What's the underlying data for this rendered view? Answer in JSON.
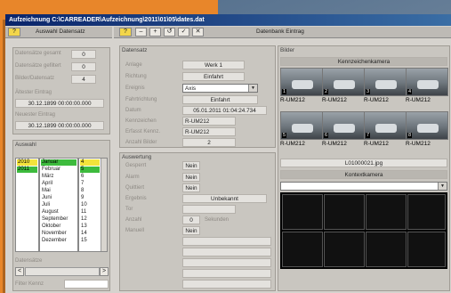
{
  "window": {
    "title": "Aufzeichnung  C:\\CARREADER\\Aufzeichnung\\2011\\01\\05\\dates.dat"
  },
  "left_toolbar": {
    "help": "?",
    "title": "Auswahl Datensatz"
  },
  "right_toolbar": {
    "help": "?",
    "buttons": [
      "–",
      "+",
      "↺",
      "✓",
      "✕"
    ],
    "title": "Datenbank Eintrag"
  },
  "stats": {
    "rows": [
      {
        "label": "Datensätze gesamt",
        "value": "0"
      },
      {
        "label": "Datensätze gefiltert",
        "value": "0"
      },
      {
        "label": "Bilder/Datensatz",
        "value": "4"
      }
    ],
    "oldest_label": "Ältester Eintrag",
    "oldest_value": "30.12.1899 00:00:00.000",
    "newest_label": "Neuester Eintrag",
    "newest_value": "30.12.1899 00:00:00.000"
  },
  "auswahl": {
    "title": "Auswahl",
    "years": [
      "2010",
      "2011"
    ],
    "months": [
      "Januar",
      "Februar",
      "März",
      "April",
      "Mai",
      "Juni",
      "Juli",
      "August",
      "September",
      "Oktober",
      "November",
      "Dezember"
    ],
    "days": [
      "4",
      "5",
      "6",
      "7",
      "8",
      "9",
      "10",
      "11",
      "12",
      "13",
      "14",
      "15"
    ],
    "footer": "Datensätze",
    "next": ">",
    "prev": "<",
    "filter_label": "Filter Kennz",
    "filter_value": ""
  },
  "datensatz": {
    "title": "Datensatz",
    "fields": [
      {
        "label": "Anlage",
        "value": "Werk 1"
      },
      {
        "label": "Richtung",
        "value": "Einfahrt"
      },
      {
        "label": "Ereignis",
        "value": "Axis"
      },
      {
        "label": "Fahrtrichtung",
        "value": "Einfahrt"
      },
      {
        "label": "Datum",
        "value": "05.01.2011 01:04:24.734"
      },
      {
        "label": "Kennzeichen",
        "value": "R-UM212"
      },
      {
        "label": "Erfasst Kennz.",
        "value": "R-UM212"
      },
      {
        "label": "Anzahl Bilder",
        "value": "2"
      }
    ]
  },
  "auswertung": {
    "title": "Auswertung",
    "fields": [
      {
        "label": "Gesperrt",
        "value": "Nein"
      },
      {
        "label": "Alarm",
        "value": "Nein"
      },
      {
        "label": "Quittiert",
        "value": "Nein"
      },
      {
        "label": "Ergebnis",
        "value": "Unbekannt"
      },
      {
        "label": "Tor",
        "value": ""
      },
      {
        "label": "Anzahl",
        "value": "0"
      },
      {
        "label": "Manuell",
        "value": "Nein"
      }
    ],
    "extra_label": "Sekunden"
  },
  "bilder": {
    "title": "Bilder",
    "camera_label": "Kennzeichenkamera",
    "images": [
      {
        "num": "1",
        "caption": "R-UM212"
      },
      {
        "num": "2",
        "caption": "R-UM212"
      },
      {
        "num": "3",
        "caption": "R-UM212"
      },
      {
        "num": "4",
        "caption": "R-UM212"
      },
      {
        "num": "5",
        "caption": "R-UM212"
      },
      {
        "num": "6",
        "caption": "R-UM212"
      },
      {
        "num": "7",
        "caption": "R-UM212"
      },
      {
        "num": "8",
        "caption": "R-UM212"
      }
    ],
    "filename": "L01000021.jpg",
    "overview_label": "Kontextkamera",
    "overview_select": ""
  }
}
